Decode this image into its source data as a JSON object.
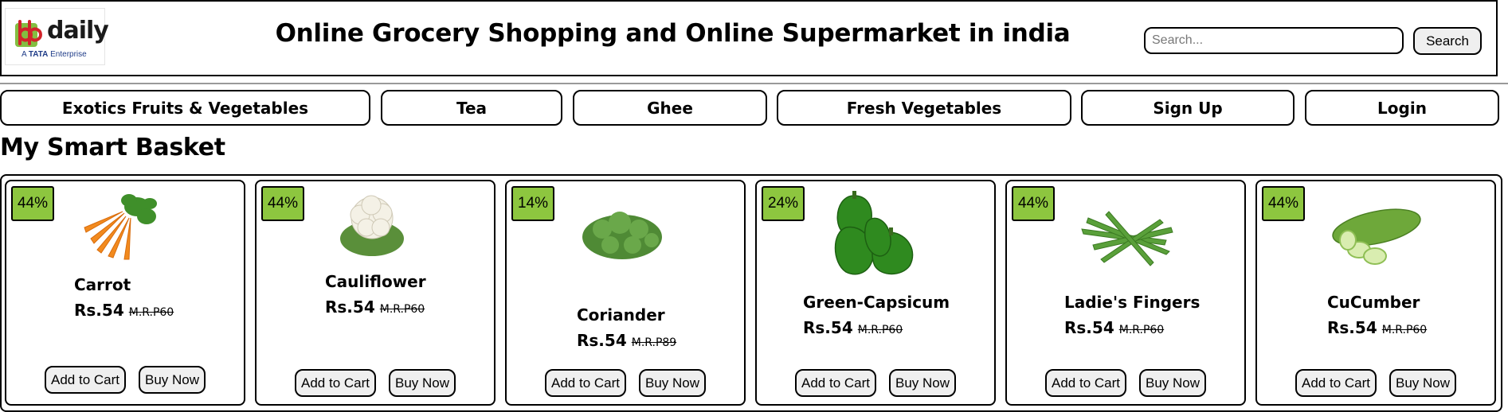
{
  "header": {
    "logo": {
      "brand": "daily",
      "tag_prefix": "A",
      "tag_bold": "TATA",
      "tag_suffix": "Enterprise"
    },
    "title": "Online Grocery Shopping and Online Supermarket in india",
    "search": {
      "placeholder": "Search...",
      "value": "",
      "button_label": "Search"
    }
  },
  "nav": {
    "items": [
      {
        "label": "Exotics Fruits & Vegetables"
      },
      {
        "label": "Tea"
      },
      {
        "label": "Ghee"
      },
      {
        "label": "Fresh Vegetables"
      },
      {
        "label": "Sign Up"
      },
      {
        "label": "Login"
      }
    ]
  },
  "section": {
    "title": "My Smart Basket"
  },
  "products": [
    {
      "discount": "44%",
      "name": "Carrot",
      "price": "Rs.54",
      "mrp": "M.R.P60",
      "image": "carrot-image",
      "add_label": "Add to Cart",
      "buy_label": "Buy Now"
    },
    {
      "discount": "44%",
      "name": "Cauliflower",
      "price": "Rs.54",
      "mrp": "M.R.P60",
      "image": "cauliflower-image",
      "add_label": "Add to Cart",
      "buy_label": "Buy Now"
    },
    {
      "discount": "14%",
      "name": "Coriander",
      "price": "Rs.54",
      "mrp": "M.R.P89",
      "image": "coriander-image",
      "add_label": "Add to Cart",
      "buy_label": "Buy Now"
    },
    {
      "discount": "24%",
      "name": "Green-Capsicum",
      "price": "Rs.54",
      "mrp": "M.R.P60",
      "image": "capsicum-image",
      "add_label": "Add to Cart",
      "buy_label": "Buy Now"
    },
    {
      "discount": "44%",
      "name": "Ladie's Fingers",
      "price": "Rs.54",
      "mrp": "M.R.P60",
      "image": "okra-image",
      "add_label": "Add to Cart",
      "buy_label": "Buy Now"
    },
    {
      "discount": "44%",
      "name": "CuCumber",
      "price": "Rs.54",
      "mrp": "M.R.P60",
      "image": "cucumber-image",
      "add_label": "Add to Cart",
      "buy_label": "Buy Now"
    }
  ],
  "colors": {
    "badge": "#8dc63f",
    "logo_red": "#d2232a",
    "logo_green": "#84be41"
  }
}
